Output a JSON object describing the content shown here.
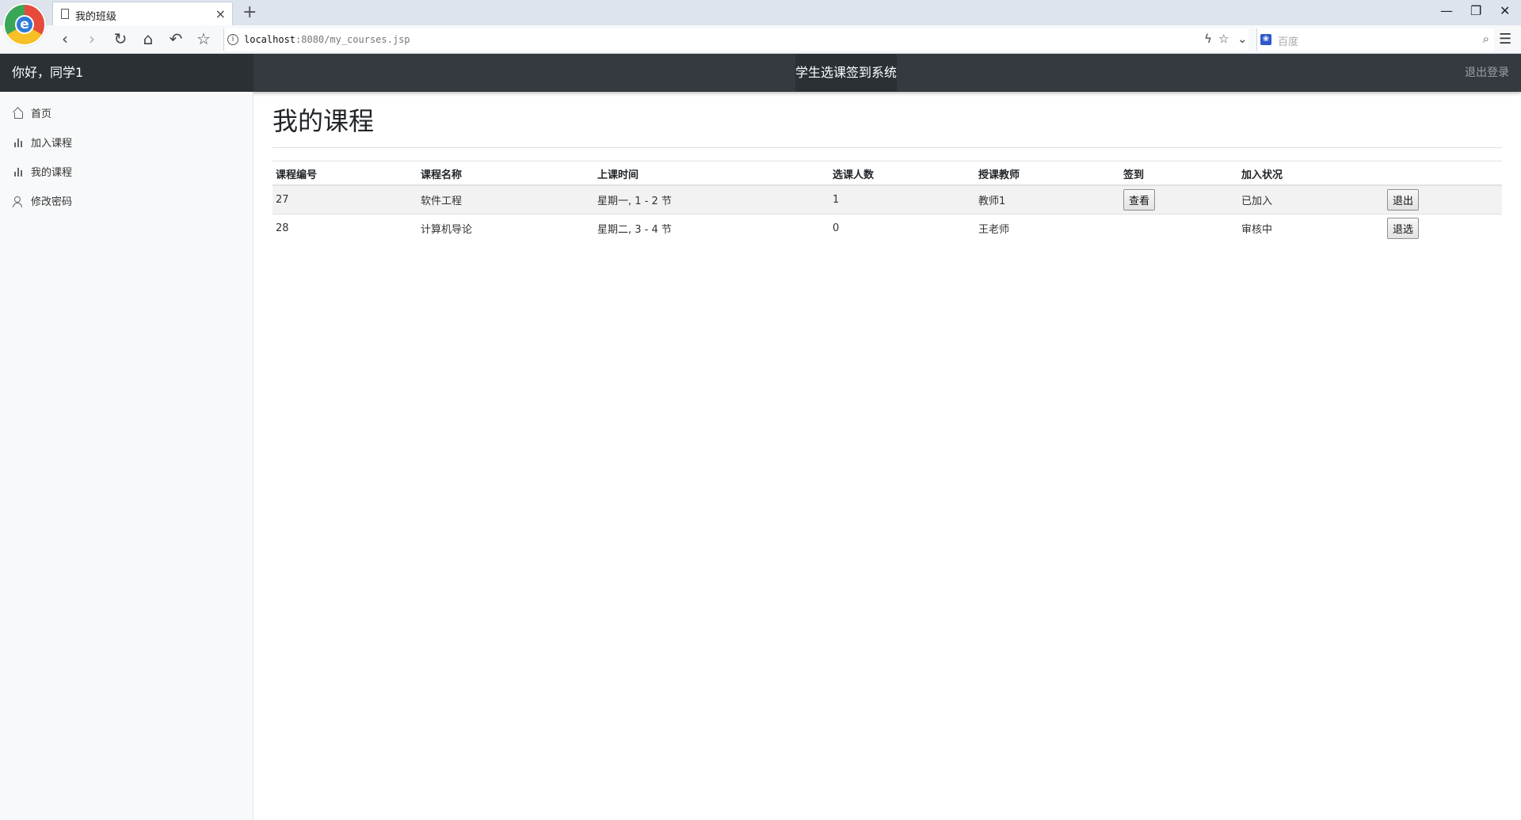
{
  "browser": {
    "tab_title": "我的班级",
    "tab_close": "×",
    "new_tab": "+",
    "url_host": "localhost",
    "url_rest": ":8080/my_courses.jsp",
    "search_placeholder": "百度",
    "window_controls": {
      "minimize": "—",
      "restore": "❐",
      "close": "✕"
    }
  },
  "header": {
    "greeting": "你好，同学1",
    "system_title": "学生选课签到系统",
    "logout": "退出登录"
  },
  "sidebar": {
    "items": [
      {
        "label": "首页",
        "icon": "home-icon"
      },
      {
        "label": "加入课程",
        "icon": "bar-chart-icon"
      },
      {
        "label": "我的课程",
        "icon": "bar-chart-icon"
      },
      {
        "label": "修改密码",
        "icon": "users-icon"
      }
    ]
  },
  "main": {
    "title": "我的课程",
    "table": {
      "headers": [
        "课程编号",
        "课程名称",
        "上课时间",
        "选课人数",
        "授课教师",
        "签到",
        "加入状况",
        ""
      ],
      "rows": [
        {
          "id": "27",
          "name": "软件工程",
          "time": "星期一, 1 - 2 节",
          "count": "1",
          "teacher": "教师1",
          "signin_button": "查看",
          "status": "已加入",
          "action_button": "退出"
        },
        {
          "id": "28",
          "name": "计算机导论",
          "time": "星期二, 3 - 4 节",
          "count": "0",
          "teacher": "王老师",
          "signin_button": "",
          "status": "审核中",
          "action_button": "退选"
        }
      ]
    }
  }
}
